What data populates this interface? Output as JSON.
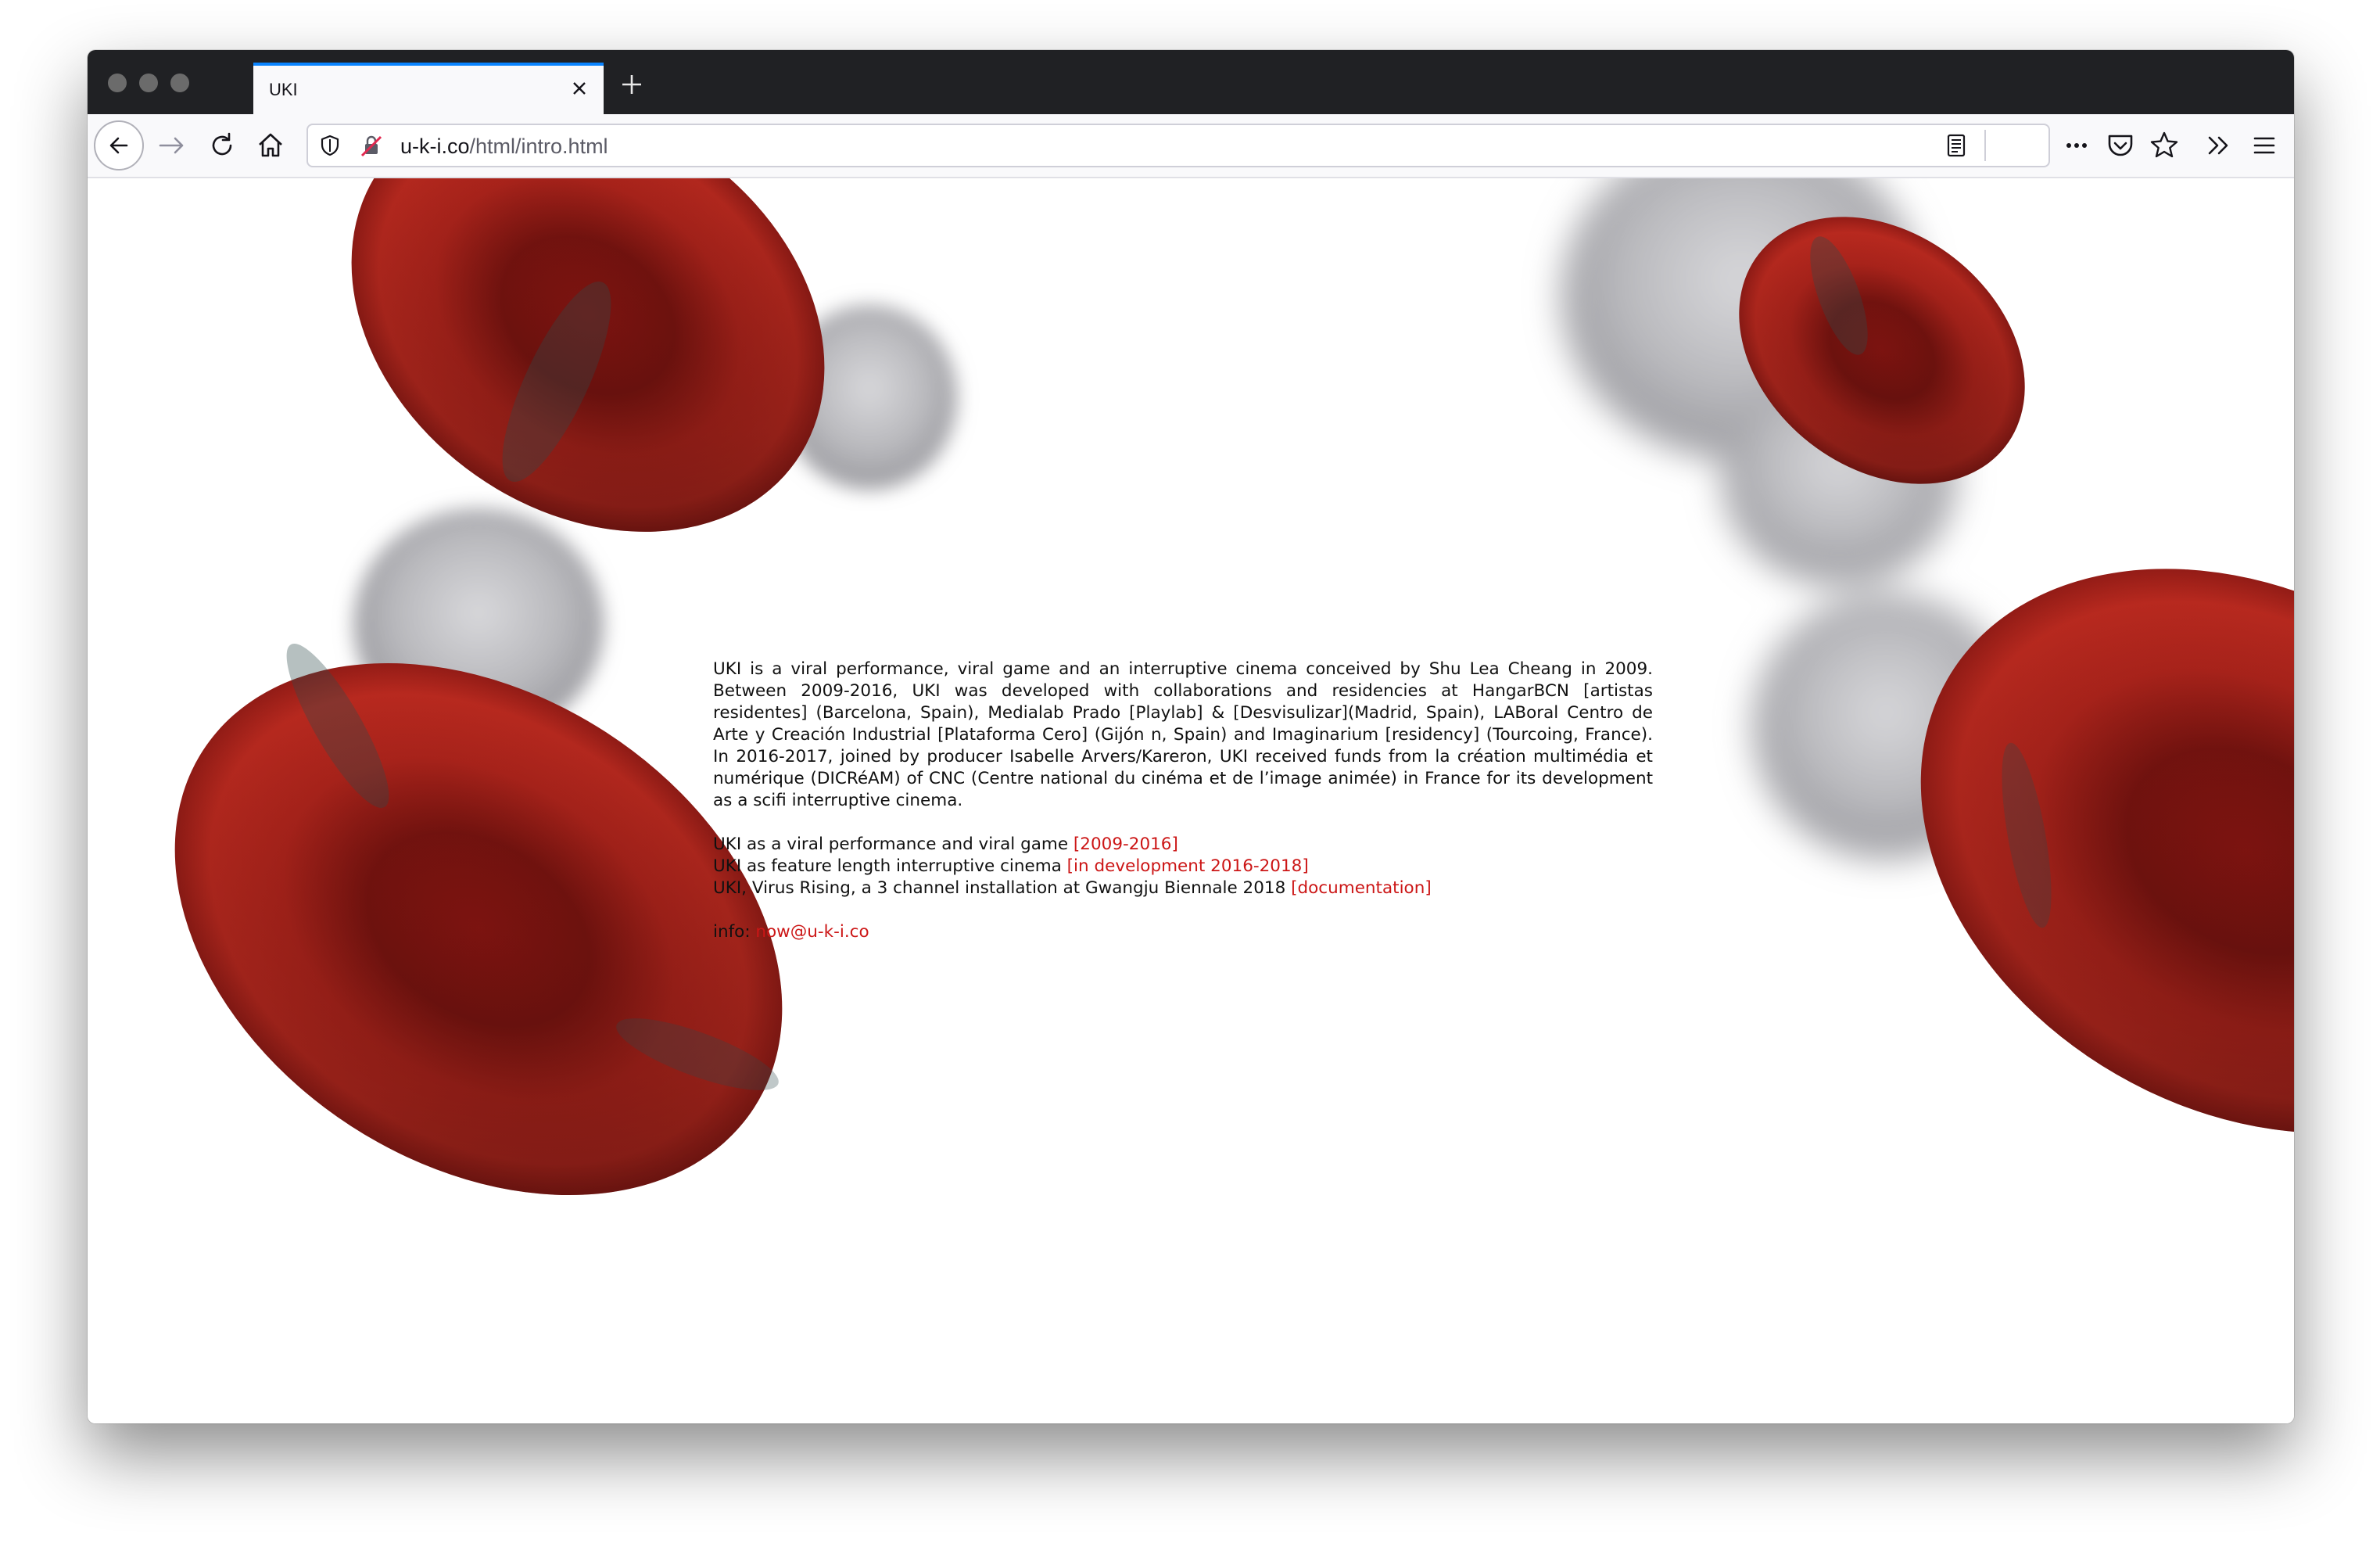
{
  "browser": {
    "tab_title": "UKI",
    "url_domain": "u-k-i.co",
    "url_path": "/html/intro.html",
    "accent_color": "#0a84ff",
    "icons": [
      "back-arrow-icon",
      "forward-arrow-icon",
      "reload-icon",
      "home-icon",
      "shield-icon",
      "tracking-blocked-icon",
      "reader-view-icon",
      "more-icon",
      "pocket-icon",
      "bookmark-star-icon",
      "overflow-chevron-icon",
      "menu-hamburger-icon"
    ]
  },
  "page": {
    "intro_paragraph": "UKI is a viral performance, viral game and an interruptive cinema conceived by Shu Lea Cheang in 2009. Between 2009-2016, UKI was developed with collaborations and residencies at HangarBCN [artistas residentes] (Barcelona, Spain), Medialab Prado [Playlab] & [Desvisulizar](Madrid, Spain), LABoral Centro de Arte y Creación Industrial [Plataforma Cero] (Gijón n, Spain) and Imaginarium [residency] (Tourcoing, France). In 2016-2017, joined by producer Isabelle Arvers/Kareron, UKI received funds from la création multimédia et numérique (DICRéAM) of CNC (Centre national du cinéma et de l’image animée) in France for its development as a scifi interruptive cinema.",
    "lines": [
      {
        "text": "UKI as a viral performance and viral game ",
        "link": "[2009-2016]"
      },
      {
        "text": "UKI as feature length interruptive cinema ",
        "link": "[in development 2016-2018]"
      },
      {
        "text": "UKI, Virus Rising, a 3 channel installation at Gwangju Biennale 2018 ",
        "link": "[documentation]"
      }
    ],
    "info_label": "info: ",
    "info_email": "now@u-k-i.co",
    "link_color": "#cc1616",
    "cell_color": "#b3241c"
  }
}
